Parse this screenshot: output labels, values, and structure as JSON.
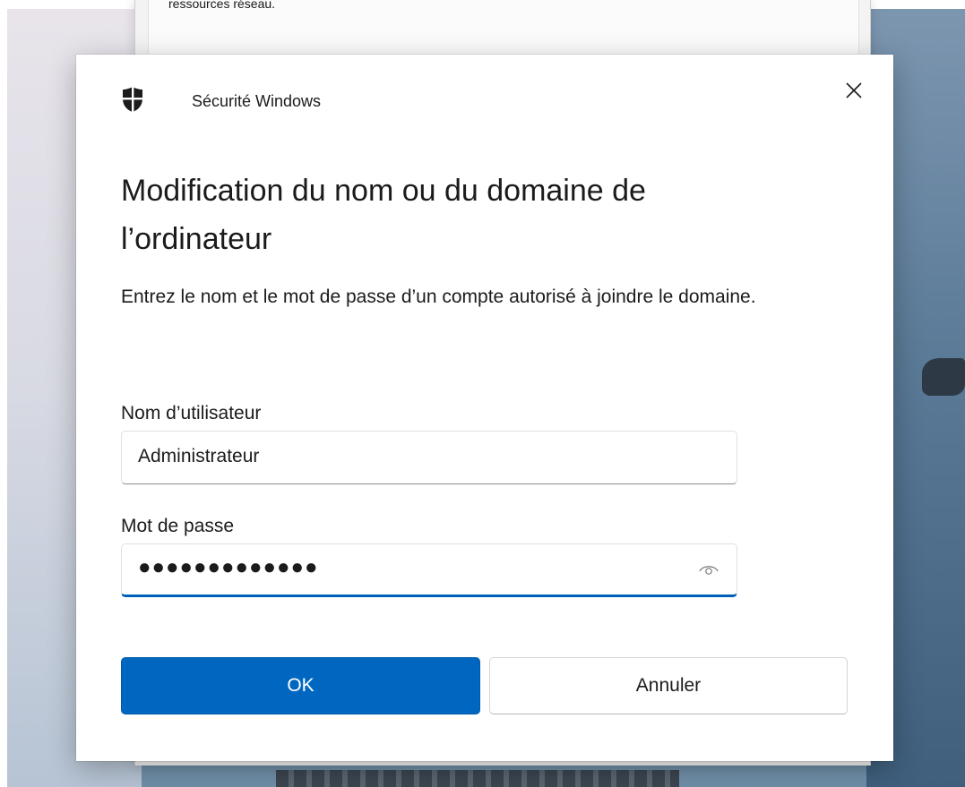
{
  "background_window": {
    "partial_text": "ressources réseau."
  },
  "dialog": {
    "app_name": "Sécurité Windows",
    "title": "Modification du nom ou du domaine de l’ordinateur",
    "description": "Entrez le nom et le mot de passe d’un compte autorisé à joindre le domaine.",
    "username": {
      "label": "Nom d’utilisateur",
      "value": "Administrateur"
    },
    "password": {
      "label": "Mot de passe",
      "masked_value": "●●●●●●●●●●●●●",
      "focused": true
    },
    "buttons": {
      "ok_label": "OK",
      "cancel_label": "Annuler"
    },
    "icons": {
      "app": "shield-icon",
      "close": "close-icon",
      "reveal": "eye-icon"
    }
  },
  "colors": {
    "accent": "#0067c0",
    "focus_underline": "#005fb8",
    "dialog_background": "#ffffff",
    "text": "#1b1b1b"
  }
}
